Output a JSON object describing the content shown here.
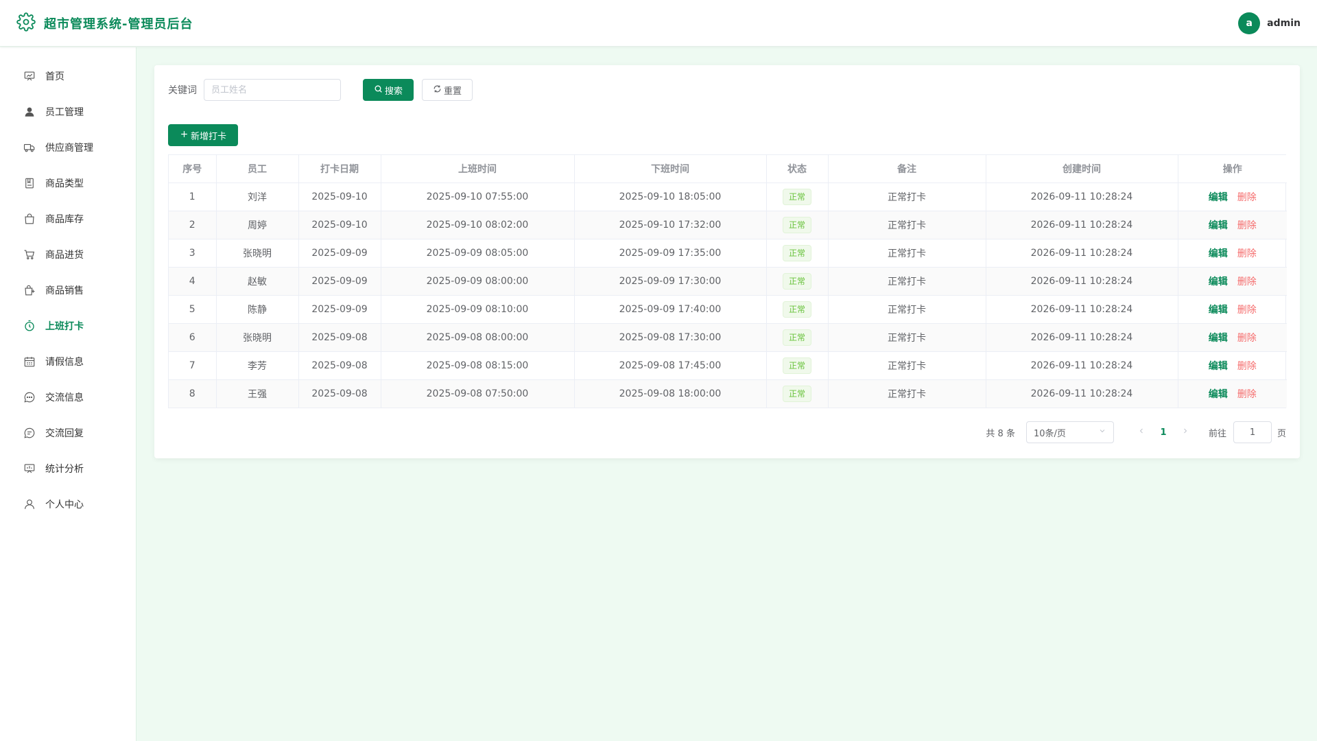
{
  "header": {
    "title": "超市管理系统-管理员后台",
    "avatar_letter": "a",
    "username": "admin"
  },
  "sidebar": {
    "items": [
      {
        "label": "首页",
        "icon": "dashboard-icon",
        "active": false
      },
      {
        "label": "员工管理",
        "icon": "user-filled-icon",
        "active": false
      },
      {
        "label": "供应商管理",
        "icon": "truck-icon",
        "active": false
      },
      {
        "label": "商品类型",
        "icon": "notebook-icon",
        "active": false
      },
      {
        "label": "商品库存",
        "icon": "shopping-bag-icon",
        "active": false
      },
      {
        "label": "商品进货",
        "icon": "shopping-cart-icon",
        "active": false
      },
      {
        "label": "商品销售",
        "icon": "sold-out-icon",
        "active": false
      },
      {
        "label": "上班打卡",
        "icon": "stopwatch-icon",
        "active": true
      },
      {
        "label": "请假信息",
        "icon": "calendar-icon",
        "active": false
      },
      {
        "label": "交流信息",
        "icon": "chat-dot-icon",
        "active": false
      },
      {
        "label": "交流回复",
        "icon": "chat-line-icon",
        "active": false
      },
      {
        "label": "统计分析",
        "icon": "data-board-icon",
        "active": false
      },
      {
        "label": "个人中心",
        "icon": "user-icon",
        "active": false
      }
    ]
  },
  "search": {
    "label": "关键词",
    "placeholder": "员工姓名",
    "search_label": "搜索",
    "reset_label": "重置",
    "add_label": "新增打卡"
  },
  "table": {
    "columns": [
      "序号",
      "员工",
      "打卡日期",
      "上班时间",
      "下班时间",
      "状态",
      "备注",
      "创建时间",
      "操作"
    ],
    "edit_label": "编辑",
    "delete_label": "删除",
    "rows": [
      {
        "no": "1",
        "employee": "刘洋",
        "date": "2025-09-10",
        "on": "2025-09-10 07:55:00",
        "off": "2025-09-10 18:05:00",
        "status": "正常",
        "remark": "正常打卡",
        "created": "2026-09-11 10:28:24"
      },
      {
        "no": "2",
        "employee": "周婷",
        "date": "2025-09-10",
        "on": "2025-09-10 08:02:00",
        "off": "2025-09-10 17:32:00",
        "status": "正常",
        "remark": "正常打卡",
        "created": "2026-09-11 10:28:24"
      },
      {
        "no": "3",
        "employee": "张晓明",
        "date": "2025-09-09",
        "on": "2025-09-09 08:05:00",
        "off": "2025-09-09 17:35:00",
        "status": "正常",
        "remark": "正常打卡",
        "created": "2026-09-11 10:28:24"
      },
      {
        "no": "4",
        "employee": "赵敏",
        "date": "2025-09-09",
        "on": "2025-09-09 08:00:00",
        "off": "2025-09-09 17:30:00",
        "status": "正常",
        "remark": "正常打卡",
        "created": "2026-09-11 10:28:24"
      },
      {
        "no": "5",
        "employee": "陈静",
        "date": "2025-09-09",
        "on": "2025-09-09 08:10:00",
        "off": "2025-09-09 17:40:00",
        "status": "正常",
        "remark": "正常打卡",
        "created": "2026-09-11 10:28:24"
      },
      {
        "no": "6",
        "employee": "张晓明",
        "date": "2025-09-08",
        "on": "2025-09-08 08:00:00",
        "off": "2025-09-08 17:30:00",
        "status": "正常",
        "remark": "正常打卡",
        "created": "2026-09-11 10:28:24"
      },
      {
        "no": "7",
        "employee": "李芳",
        "date": "2025-09-08",
        "on": "2025-09-08 08:15:00",
        "off": "2025-09-08 17:45:00",
        "status": "正常",
        "remark": "正常打卡",
        "created": "2026-09-11 10:28:24"
      },
      {
        "no": "8",
        "employee": "王强",
        "date": "2025-09-08",
        "on": "2025-09-08 07:50:00",
        "off": "2025-09-08 18:00:00",
        "status": "正常",
        "remark": "正常打卡",
        "created": "2026-09-11 10:28:24"
      }
    ]
  },
  "pagination": {
    "total_text": "共 8 条",
    "page_size": "10条/页",
    "current_page": "1",
    "goto_label": "前往",
    "goto_value": "1",
    "page_suffix": "页"
  },
  "colors": {
    "brand": "#0b8a5a",
    "background": "#eefaf2",
    "danger": "#f56c6c",
    "success_tag": "#67c23a"
  }
}
